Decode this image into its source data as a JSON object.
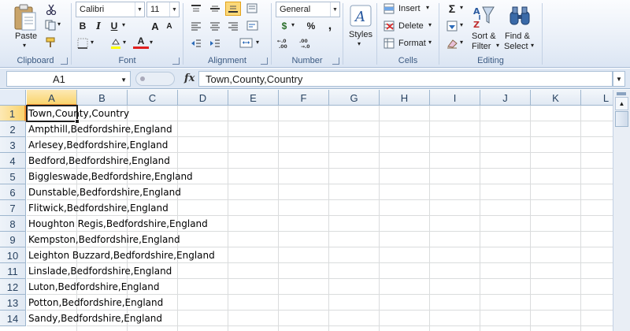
{
  "ribbon": {
    "clipboard": {
      "paste_label": "Paste",
      "group_label": "Clipboard"
    },
    "font": {
      "font_name": "Calibri",
      "font_size": "11",
      "bold": "B",
      "italic": "I",
      "underline": "U",
      "grow": "A",
      "shrink": "A",
      "font_color": "A",
      "group_label": "Font"
    },
    "alignment": {
      "group_label": "Alignment"
    },
    "number": {
      "format": "General",
      "currency": "$",
      "percent": "%",
      "comma": ",",
      "group_label": "Number"
    },
    "styles": {
      "label": "Styles"
    },
    "cells": {
      "insert_label": "Insert",
      "delete_label": "Delete",
      "format_label": "Format",
      "group_label": "Cells"
    },
    "editing": {
      "sigma": "Σ",
      "sort_line1": "Sort &",
      "sort_line2": "Filter",
      "find_line1": "Find &",
      "find_line2": "Select",
      "group_label": "Editing"
    }
  },
  "formula_bar": {
    "name_box": "A1",
    "fx": "fx",
    "formula": "Town,County,Country"
  },
  "columns": [
    "A",
    "B",
    "C",
    "D",
    "E",
    "F",
    "G",
    "H",
    "I",
    "J",
    "K",
    "L"
  ],
  "rows": [
    {
      "num": "1",
      "text": "Town,County,Country"
    },
    {
      "num": "2",
      "text": "Ampthill,Bedfordshire,England"
    },
    {
      "num": "3",
      "text": "Arlesey,Bedfordshire,England"
    },
    {
      "num": "4",
      "text": "Bedford,Bedfordshire,England"
    },
    {
      "num": "5",
      "text": "Biggleswade,Bedfordshire,England"
    },
    {
      "num": "6",
      "text": "Dunstable,Bedfordshire,England"
    },
    {
      "num": "7",
      "text": "Flitwick,Bedfordshire,England"
    },
    {
      "num": "8",
      "text": "Houghton Regis,Bedfordshire,England"
    },
    {
      "num": "9",
      "text": "Kempston,Bedfordshire,England"
    },
    {
      "num": "10",
      "text": "Leighton Buzzard,Bedfordshire,England"
    },
    {
      "num": "11",
      "text": "Linslade,Bedfordshire,England"
    },
    {
      "num": "12",
      "text": "Luton,Bedfordshire,England"
    },
    {
      "num": "13",
      "text": "Potton,Bedfordshire,England"
    },
    {
      "num": "14",
      "text": "Sandy,Bedfordshire,England"
    }
  ],
  "colors": {
    "accent": "#f29536",
    "header_bg": "#e1e9f3",
    "gridline": "#dadcdd",
    "ribbon_label": "#3b5a82"
  }
}
